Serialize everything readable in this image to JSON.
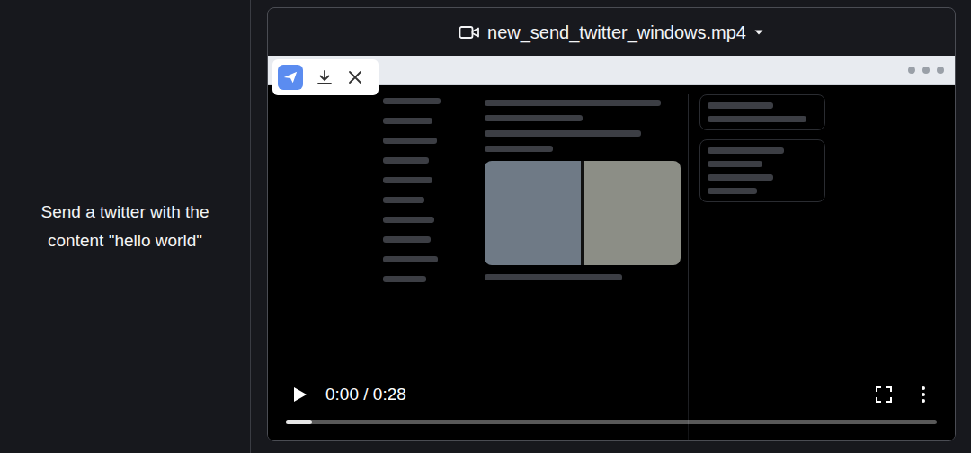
{
  "task": {
    "text": "Send a twitter with the content \"hello world\""
  },
  "video": {
    "filename": "new_send_twitter_windows.mp4"
  },
  "player": {
    "playing": false,
    "time": "0:00 / 0:28",
    "progress": {
      "level": 0.04
    }
  }
}
